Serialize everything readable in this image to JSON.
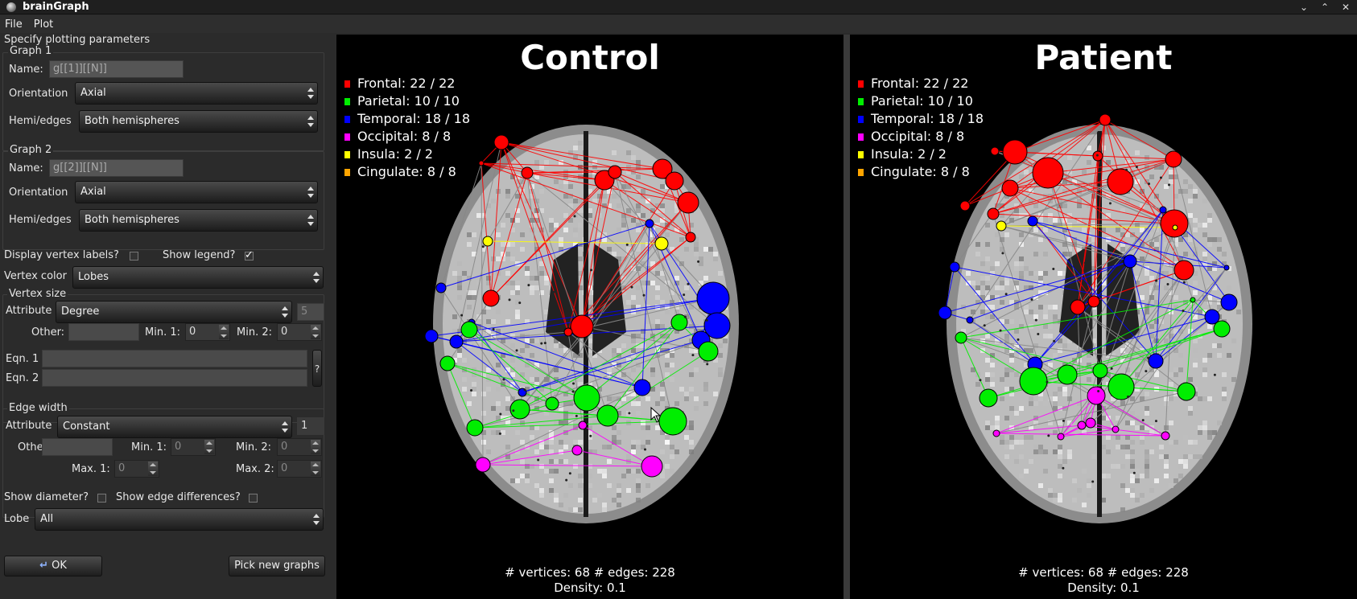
{
  "window": {
    "title": "brainGraph"
  },
  "menu": [
    "File",
    "Plot"
  ],
  "params": {
    "header": "Specify plotting parameters",
    "graph1": {
      "title": "Graph 1",
      "name_label": "Name:",
      "name_value": "g[[1]][[N]]",
      "orientation_label": "Orientation",
      "orientation_value": "Axial",
      "hemi_label": "Hemi/edges",
      "hemi_value": "Both hemispheres"
    },
    "graph2": {
      "title": "Graph 2",
      "name_label": "Name:",
      "name_value": "g[[2]][[N]]",
      "orientation_label": "Orientation",
      "orientation_value": "Axial",
      "hemi_label": "Hemi/edges",
      "hemi_value": "Both hemispheres"
    },
    "display_labels": "Display vertex labels?",
    "show_legend": "Show legend?",
    "vertex_color_label": "Vertex color",
    "vertex_color_value": "Lobes",
    "vertex_size": {
      "title": "Vertex size",
      "attribute_label": "Attribute",
      "attribute_value": "Degree",
      "attribute_num": "5",
      "other_label": "Other:",
      "min1_label": "Min. 1:",
      "min1_value": "0",
      "min2_label": "Min. 2:",
      "min2_value": "0",
      "eqn1_label": "Eqn. 1",
      "eqn2_label": "Eqn. 2",
      "help": "?"
    },
    "edge_width": {
      "title": "Edge width",
      "attribute_label": "Attribute",
      "attribute_value": "Constant",
      "attribute_num": "1",
      "other_label": "Other:",
      "min1_label": "Min. 1:",
      "min1_value": "0",
      "min2_label": "Min. 2:",
      "min2_value": "0",
      "max1_label": "Max. 1:",
      "max1_value": "0",
      "max2_label": "Max. 2:",
      "max2_value": "0"
    },
    "show_diameter": "Show diameter?",
    "show_edge_diff": "Show edge differences?",
    "lobe_label": "Lobe",
    "lobe_value": "All",
    "ok_label": "OK",
    "pick_label": "Pick new graphs"
  },
  "colors": {
    "frontal": "#ff0000",
    "parietal": "#00ee00",
    "temporal": "#0000ff",
    "occipital": "#ff00ff",
    "insula": "#ffff00",
    "cingulate": "#ffa500"
  },
  "plots": [
    {
      "title": "Control",
      "legend": [
        "Frontal: 22 / 22",
        "Parietal: 10 / 10",
        "Temporal: 18 / 18",
        "Occipital: 8 / 8",
        "Insula: 2 / 2",
        "Cingulate: 8 / 8"
      ],
      "stats_line1": "# vertices:  68 # edges:  228",
      "stats_line2": "Density:  0.1"
    },
    {
      "title": "Patient",
      "legend": [
        "Frontal: 22 / 22",
        "Parietal: 10 / 10",
        "Temporal: 18 / 18",
        "Occipital: 8 / 8",
        "Insula: 2 / 2",
        "Cingulate: 8 / 8"
      ],
      "stats_line1": "# vertices:  68 # edges:  228",
      "stats_line2": "Density:  0.1"
    }
  ]
}
